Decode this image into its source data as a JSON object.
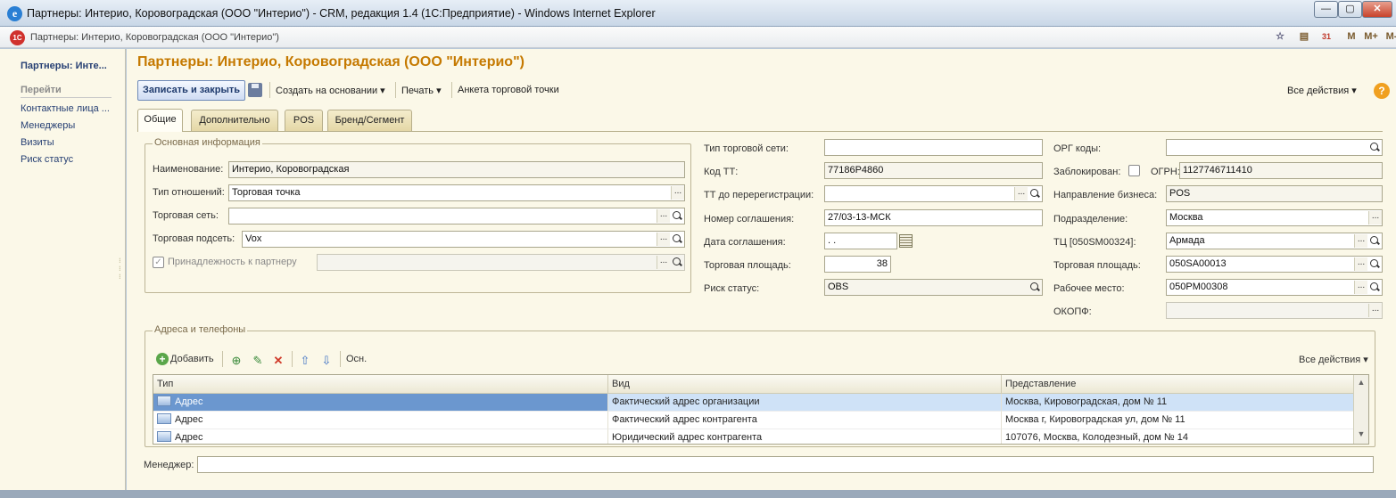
{
  "window": {
    "title": "Партнеры: Интерио, Коровоградская (ООО \"Интерио\") - CRM, редакция 1.4 (1С:Предприятие) - Windows Internet Explorer",
    "minimize": "—",
    "maximize": "▢",
    "close": "✕"
  },
  "address_bar": {
    "logo": "1C",
    "text": "Партнеры: Интерио, Коровоградская (ООО \"Интерио\")",
    "icons": [
      "☆",
      "▤",
      "31",
      "M",
      "M+",
      "M-"
    ]
  },
  "sidebar": {
    "current": "Партнеры: Инте...",
    "group_title": "Перейти",
    "links": [
      "Контактные лица ...",
      "Менеджеры",
      "Визиты",
      "Риск статус"
    ]
  },
  "page": {
    "title": "Партнеры: Интерио, Коровоградская (ООО \"Интерио\")"
  },
  "toolbar": {
    "save_close": "Записать и закрыть",
    "create_based": "Создать на основании",
    "print": "Печать",
    "questionnaire": "Анкета торговой точки",
    "all_actions": "Все действия",
    "help": "?"
  },
  "tabs": [
    "Общие",
    "Дополнительно",
    "POS",
    "Бренд/Сегмент"
  ],
  "main_info": {
    "legend": "Основная информация",
    "name_label": "Наименование:",
    "name_value": "Интерио, Коровоградская",
    "relation_label": "Тип отношений:",
    "relation_value": "Торговая точка",
    "network_label": "Торговая сеть:",
    "network_value": "",
    "subnetwork_label": "Торговая подсеть:",
    "subnetwork_value": "Vox",
    "belongs_label": "Принадлежность к партнеру",
    "belongs_value": "",
    "belongs_checked": true
  },
  "middle": {
    "network_type_label": "Тип торговой сети:",
    "network_type_value": "",
    "tt_code_label": "Код ТТ:",
    "tt_code_value": "77186P4860",
    "tt_prev_label": "ТТ до перерегистрации:",
    "tt_prev_value": "",
    "agreement_num_label": "Номер соглашения:",
    "agreement_num_value": "27/03-13-МСК",
    "agreement_date_label": "Дата соглашения:",
    "agreement_date_value": " .  .",
    "area_label": "Торговая площадь:",
    "area_value": "38",
    "risk_label": "Риск статус:",
    "risk_value": "OBS"
  },
  "right": {
    "org_codes_label": "ОРГ коды:",
    "org_codes_value": "",
    "blocked_label": "Заблокирован:",
    "blocked": false,
    "ogrn_label": "ОГРН:",
    "ogrn_value": "1127746711410",
    "business_label": "Направление бизнеса:",
    "business_value": "POS",
    "division_label": "Подразделение:",
    "division_value": "Москва",
    "tc_label": "ТЦ [050SM00324]:",
    "tc_value": "Армада",
    "area2_label": "Торговая площадь:",
    "area2_value": "050SA00013",
    "workplace_label": "Рабочее место:",
    "workplace_value": "050PM00308",
    "okopf_label": "ОКОПФ:",
    "okopf_value": ""
  },
  "addresses": {
    "legend": "Адреса и телефоны",
    "add": "Добавить",
    "main": "Осн.",
    "all_actions": "Все действия",
    "columns": [
      "Тип",
      "Вид",
      "Представление"
    ],
    "rows": [
      {
        "type": "Адрес",
        "kind": "Фактический адрес организации",
        "repr": "Москва, Кировоградская, дом № 11"
      },
      {
        "type": "Адрес",
        "kind": "Фактический адрес контрагента",
        "repr": "Москва г, Кировоградская ул, дом № 11"
      },
      {
        "type": "Адрес",
        "kind": "Юридический адрес контрагента",
        "repr": "107076, Москва, Колодезный, дом № 14"
      }
    ]
  },
  "manager": {
    "label": "Менеджер:",
    "value": ""
  }
}
